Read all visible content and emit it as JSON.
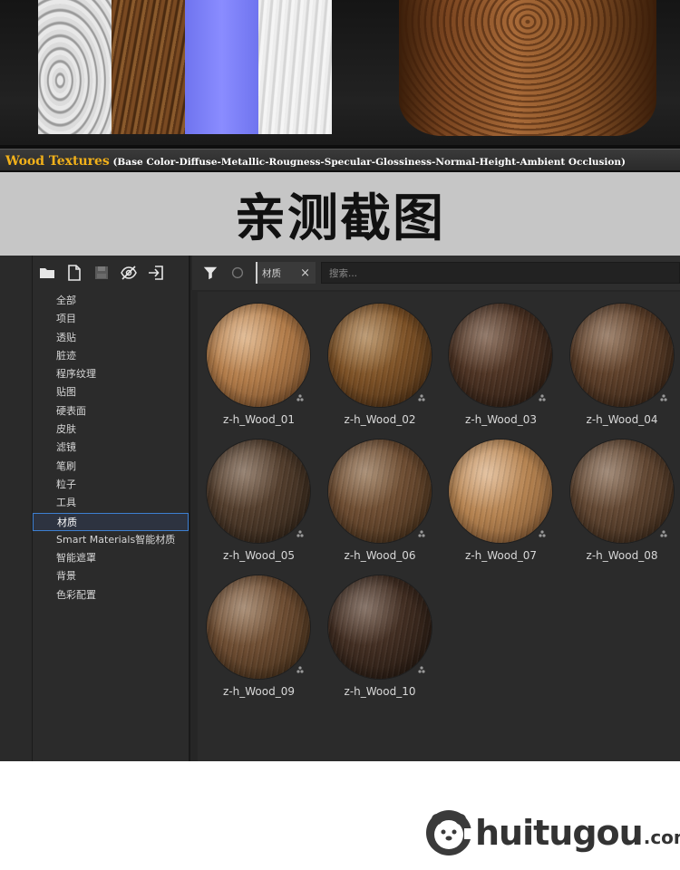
{
  "preview": {
    "caption_title": "Wood Textures",
    "caption_subtitle": " (Base Color-Diffuse-Metallic-Rougness-Specular-Glossiness-Normal-Height-Ambient Occlusion)"
  },
  "headline": "亲测截图",
  "toolbar": {
    "icons": [
      "folder-icon",
      "new-file-icon",
      "save-icon",
      "hide-icon",
      "import-icon"
    ]
  },
  "categories": [
    {
      "label": "全部"
    },
    {
      "label": "项目"
    },
    {
      "label": "透贴"
    },
    {
      "label": "脏迹"
    },
    {
      "label": "程序纹理"
    },
    {
      "label": "贴图"
    },
    {
      "label": "硬表面"
    },
    {
      "label": "皮肤"
    },
    {
      "label": "滤镜"
    },
    {
      "label": "笔刷"
    },
    {
      "label": "粒子"
    },
    {
      "label": "工具"
    },
    {
      "label": "材质",
      "active": true
    },
    {
      "label": "Smart Materials智能材质"
    },
    {
      "label": "智能遮罩"
    },
    {
      "label": "背景"
    },
    {
      "label": "色彩配置"
    }
  ],
  "filter_bar": {
    "tag_label": "材质",
    "tag_close": "×",
    "search_placeholder": "搜索..."
  },
  "materials": [
    {
      "name": "z-h_Wood_01",
      "base": "#b07a48",
      "light": "#d9a672",
      "dark": "#5e3a1c"
    },
    {
      "name": "z-h_Wood_02",
      "base": "#7a4f25",
      "light": "#a87a45",
      "dark": "#3a230e"
    },
    {
      "name": "z-h_Wood_03",
      "base": "#4a3122",
      "light": "#6d4b35",
      "dark": "#22150c"
    },
    {
      "name": "z-h_Wood_04",
      "base": "#5a3d28",
      "light": "#7f5a3d",
      "dark": "#2a1a0e"
    },
    {
      "name": "z-h_Wood_05",
      "base": "#4e3a2a",
      "light": "#735842",
      "dark": "#241a10"
    },
    {
      "name": "z-h_Wood_06",
      "base": "#6a4a30",
      "light": "#8e6a48",
      "dark": "#33220f"
    },
    {
      "name": "z-h_Wood_07",
      "base": "#b3814f",
      "light": "#dcae80",
      "dark": "#6a4424"
    },
    {
      "name": "z-h_Wood_08",
      "base": "#5e4430",
      "light": "#82634a",
      "dark": "#2c1d10"
    },
    {
      "name": "z-h_Wood_09",
      "base": "#6a4a30",
      "light": "#8e6a4a",
      "dark": "#33220f"
    },
    {
      "name": "z-h_Wood_10",
      "base": "#3e2b20",
      "light": "#5e4434",
      "dark": "#1a110a"
    }
  ],
  "footer": {
    "logo_text": "huitugou",
    "logo_domain": ".com"
  }
}
